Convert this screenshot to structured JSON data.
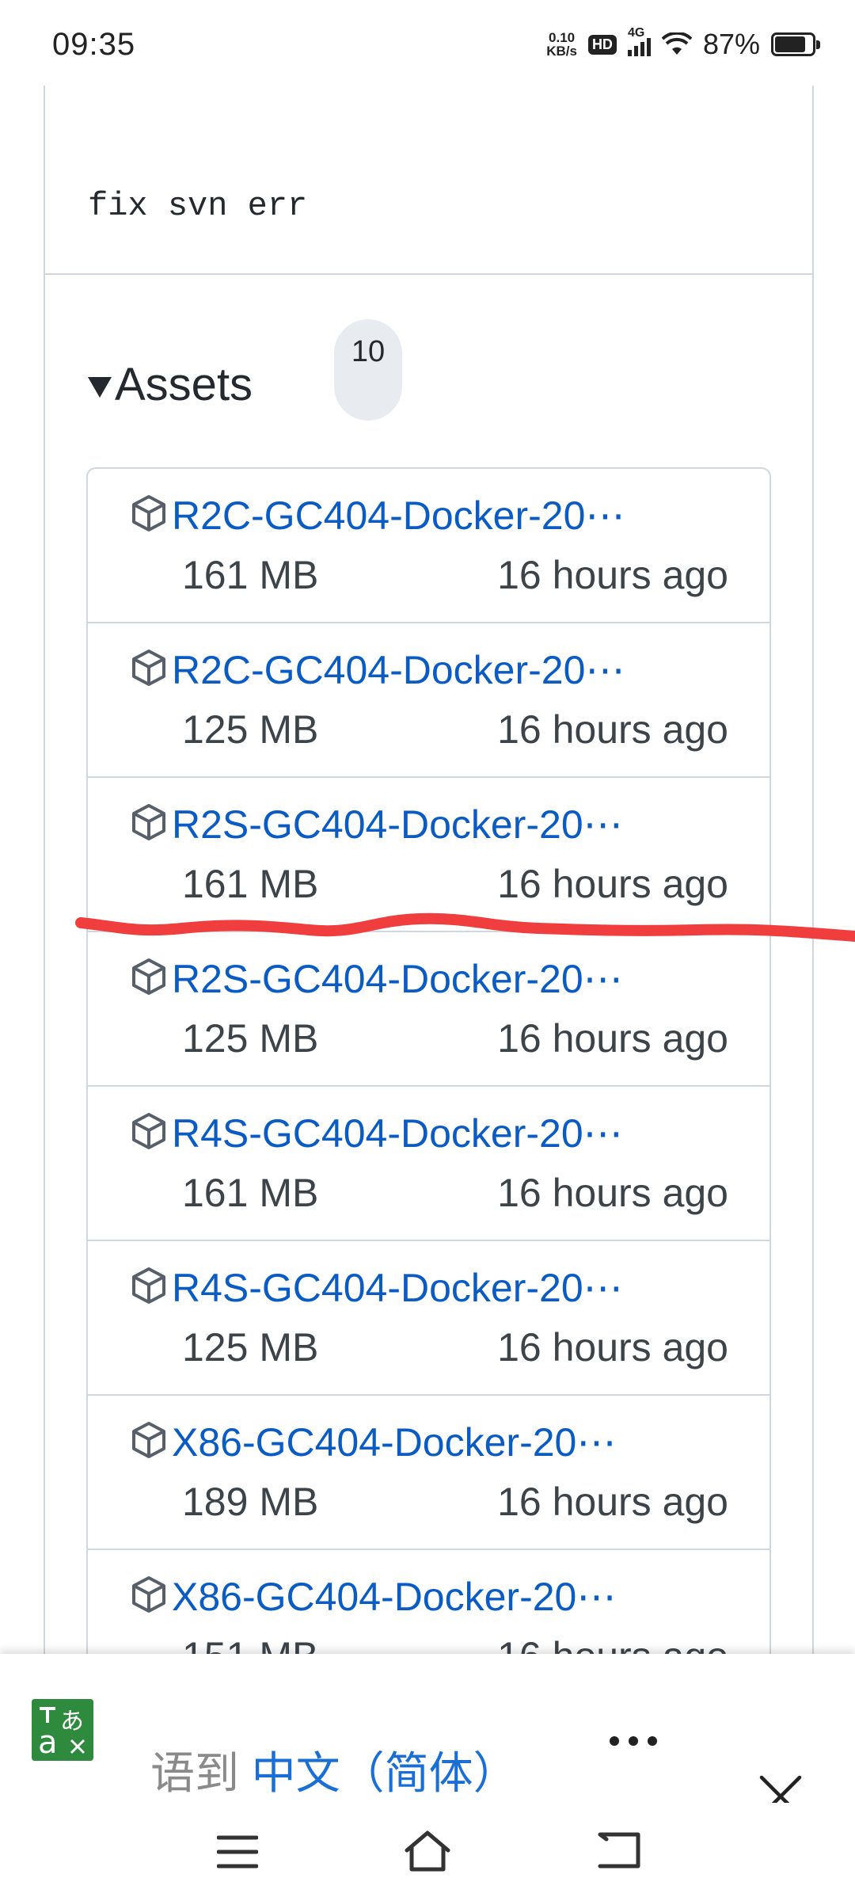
{
  "status_bar": {
    "time": "09:35",
    "net_speed_value": "0.10",
    "net_speed_unit": "KB/s",
    "hd": "HD",
    "network": "4G",
    "battery": "87%",
    "battery_level": 0.87
  },
  "release": {
    "commit_message": "fix svn err",
    "assets_label": "Assets",
    "assets_count": "10",
    "assets": [
      {
        "name": "R2C-GC404-Docker-20⋯",
        "size": "161 MB",
        "time": "16 hours ago"
      },
      {
        "name": "R2C-GC404-Docker-20⋯",
        "size": "125 MB",
        "time": "16 hours ago"
      },
      {
        "name": "R2S-GC404-Docker-20⋯",
        "size": "161 MB",
        "time": "16 hours ago"
      },
      {
        "name": "R2S-GC404-Docker-20⋯",
        "size": "125 MB",
        "time": "16 hours ago"
      },
      {
        "name": "R4S-GC404-Docker-20⋯",
        "size": "161 MB",
        "time": "16 hours ago"
      },
      {
        "name": "R4S-GC404-Docker-20⋯",
        "size": "125 MB",
        "time": "16 hours ago"
      },
      {
        "name": "X86-GC404-Docker-20⋯",
        "size": "189 MB",
        "time": "16 hours ago"
      },
      {
        "name": "X86-GC404-Docker-20⋯",
        "size": "151 MB",
        "time": "16 hours ago"
      }
    ]
  },
  "translate_bar": {
    "text_faded": "语到 ",
    "target_language": "中文（简体）",
    "icon": "google-translate-icon",
    "more_icon": "more-horizontal-icon",
    "close_icon": "close-icon"
  },
  "nav_bar": {
    "items": [
      "menu-icon",
      "home-icon",
      "back-icon"
    ]
  },
  "colors": {
    "link": "#0a5cc4",
    "border": "#d0d7de",
    "annotation": "#f03e3e",
    "translate_green": "#2e8b3e",
    "target_language": "#1a6fd6"
  }
}
